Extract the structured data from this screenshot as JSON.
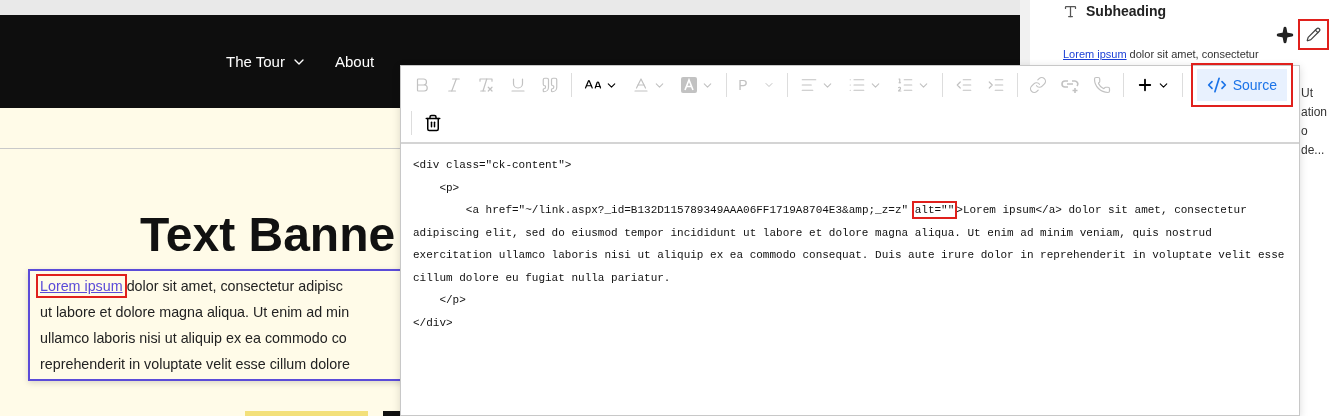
{
  "page": {
    "nav": [
      {
        "label": "The Tour",
        "has_menu": true
      },
      {
        "label": "About",
        "has_menu": false
      }
    ],
    "heading": "Text Banne",
    "paragraph": {
      "link": {
        "text": "Lorem ipsum",
        "highlighted": true
      },
      "lines": [
        "dolor sit amet, consectetur adipisc",
        "ut labore et dolore magna aliqua. Ut enim ad min",
        "ullamco laboris nisi ut aliquip ex ea commodo co",
        "reprehenderit in voluptate velit esse cillum dolore"
      ]
    }
  },
  "sidebar": {
    "title": "Subheading",
    "edit_highlighted": true,
    "preview": {
      "link": "Lorem ipsum",
      "text": "dolor sit amet, consectetur",
      "fragments": [
        "Ut",
        "ation",
        "o",
        "de..."
      ]
    }
  },
  "editor": {
    "toolbar": [
      {
        "kind": "button",
        "disabled": true
      },
      {
        "kind": "button",
        "disabled": true
      },
      {
        "kind": "button",
        "disabled": true
      },
      {
        "kind": "button",
        "disabled": true
      },
      {
        "kind": "button",
        "disabled": true
      },
      {
        "kind": "separator"
      },
      {
        "kind": "dropdown",
        "disabled": false
      },
      {
        "kind": "dropdown",
        "disabled": true
      },
      {
        "kind": "dropdown",
        "disabled": true
      },
      {
        "kind": "separator"
      },
      {
        "kind": "select",
        "label": "P",
        "disabled": true
      },
      {
        "kind": "separator"
      },
      {
        "kind": "dropdown",
        "disabled": true
      },
      {
        "kind": "dropdown",
        "disabled": true
      },
      {
        "kind": "dropdown",
        "disabled": true
      },
      {
        "kind": "separator"
      },
      {
        "kind": "button",
        "disabled": true
      },
      {
        "kind": "button",
        "disabled": true
      },
      {
        "kind": "separator"
      },
      {
        "kind": "button",
        "disabled": true
      },
      {
        "kind": "button",
        "disabled": true
      },
      {
        "kind": "button",
        "disabled": true
      },
      {
        "kind": "separator"
      },
      {
        "kind": "dropdown",
        "disabled": false
      },
      {
        "kind": "separator"
      },
      {
        "kind": "source",
        "label": "Source",
        "on": true,
        "highlighted": true
      }
    ],
    "toolbar_row2": [
      {
        "kind": "separator"
      },
      {
        "kind": "button",
        "disabled": false
      }
    ],
    "code_lines": [
      [
        {
          "text": "<div class=\"ck-content\">"
        }
      ],
      [
        {
          "text": "    <p>"
        }
      ],
      [
        {
          "text": "        <a href=\"~/link.aspx?_id=B132D115789349AAA06FF1719A8704E3&amp;_z=z\" "
        },
        {
          "text": "alt=\"\"",
          "highlighted": true
        },
        {
          "text": ">Lorem ipsum</a> dolor sit amet, consectetur adipiscing elit, sed do eiusmod tempor incididunt ut labore et dolore magna aliqua. Ut enim ad minim veniam, quis nostrud exercitation ullamco laboris nisi ut aliquip ex ea commodo consequat. Duis aute irure dolor in reprehenderit in voluptate velit esse cillum dolore eu fugiat nulla pariatur."
        }
      ],
      [
        {
          "text": "    </p>"
        }
      ],
      [
        {
          "text": "</div>"
        }
      ]
    ]
  }
}
